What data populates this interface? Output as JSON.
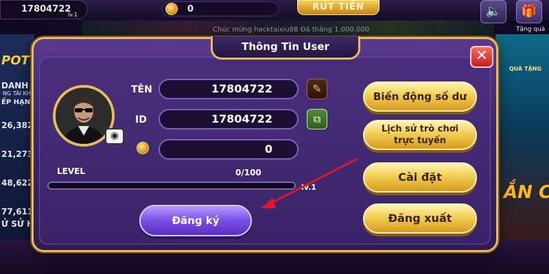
{
  "topbar": {
    "balance_value": "17804722",
    "level_tag": "lv.1",
    "coin_value": "0",
    "withdraw_label": "RÚT TIỀN",
    "gift_label": "Tặng quà",
    "ticker_text": "Chúc mừng      hacktaixiu88  Đã thắng 1.000.000"
  },
  "background": {
    "left_labels": [
      "POT",
      "DANH",
      "NG TÀI KHO",
      "ẾP HẠNG",
      "26,382",
      "21,273",
      "48,622",
      "77,611",
      "Ử SỬ H"
    ],
    "right_labels": [
      "QUÀ TẶNG",
      "ẮN C"
    ]
  },
  "dialog": {
    "title": "Thông Tin User",
    "close_symbol": "✕",
    "name_label": "TÊN",
    "name_value": "17804722",
    "id_label": "ID",
    "id_value": "17804722",
    "coin_value": "0",
    "level_label": "LEVEL",
    "level_progress_text": "0/100",
    "level_progress_fraction": 0,
    "level_number": "lv.1",
    "register_label": "Đăng ký",
    "menu": [
      {
        "line1": "Biến động số dư",
        "line2": ""
      },
      {
        "line1": "Lịch sử trò chơi",
        "line2": "trực tuyến"
      },
      {
        "line1": "Cài đặt",
        "line2": ""
      },
      {
        "line1": "Đăng xuất",
        "line2": ""
      }
    ]
  },
  "icons": {
    "camera": "camera-icon",
    "edit": "pencil-icon",
    "copy": "copy-icon",
    "coin": "coin-icon",
    "speaker": "speaker-icon",
    "gift": "gift-icon"
  },
  "colors": {
    "gold_border": "#e7be55",
    "dialog_purple": "#3d2670",
    "register_purple": "#7a4fe6",
    "close_red": "#c81e1e",
    "annotation_arrow": "#e0162b"
  }
}
